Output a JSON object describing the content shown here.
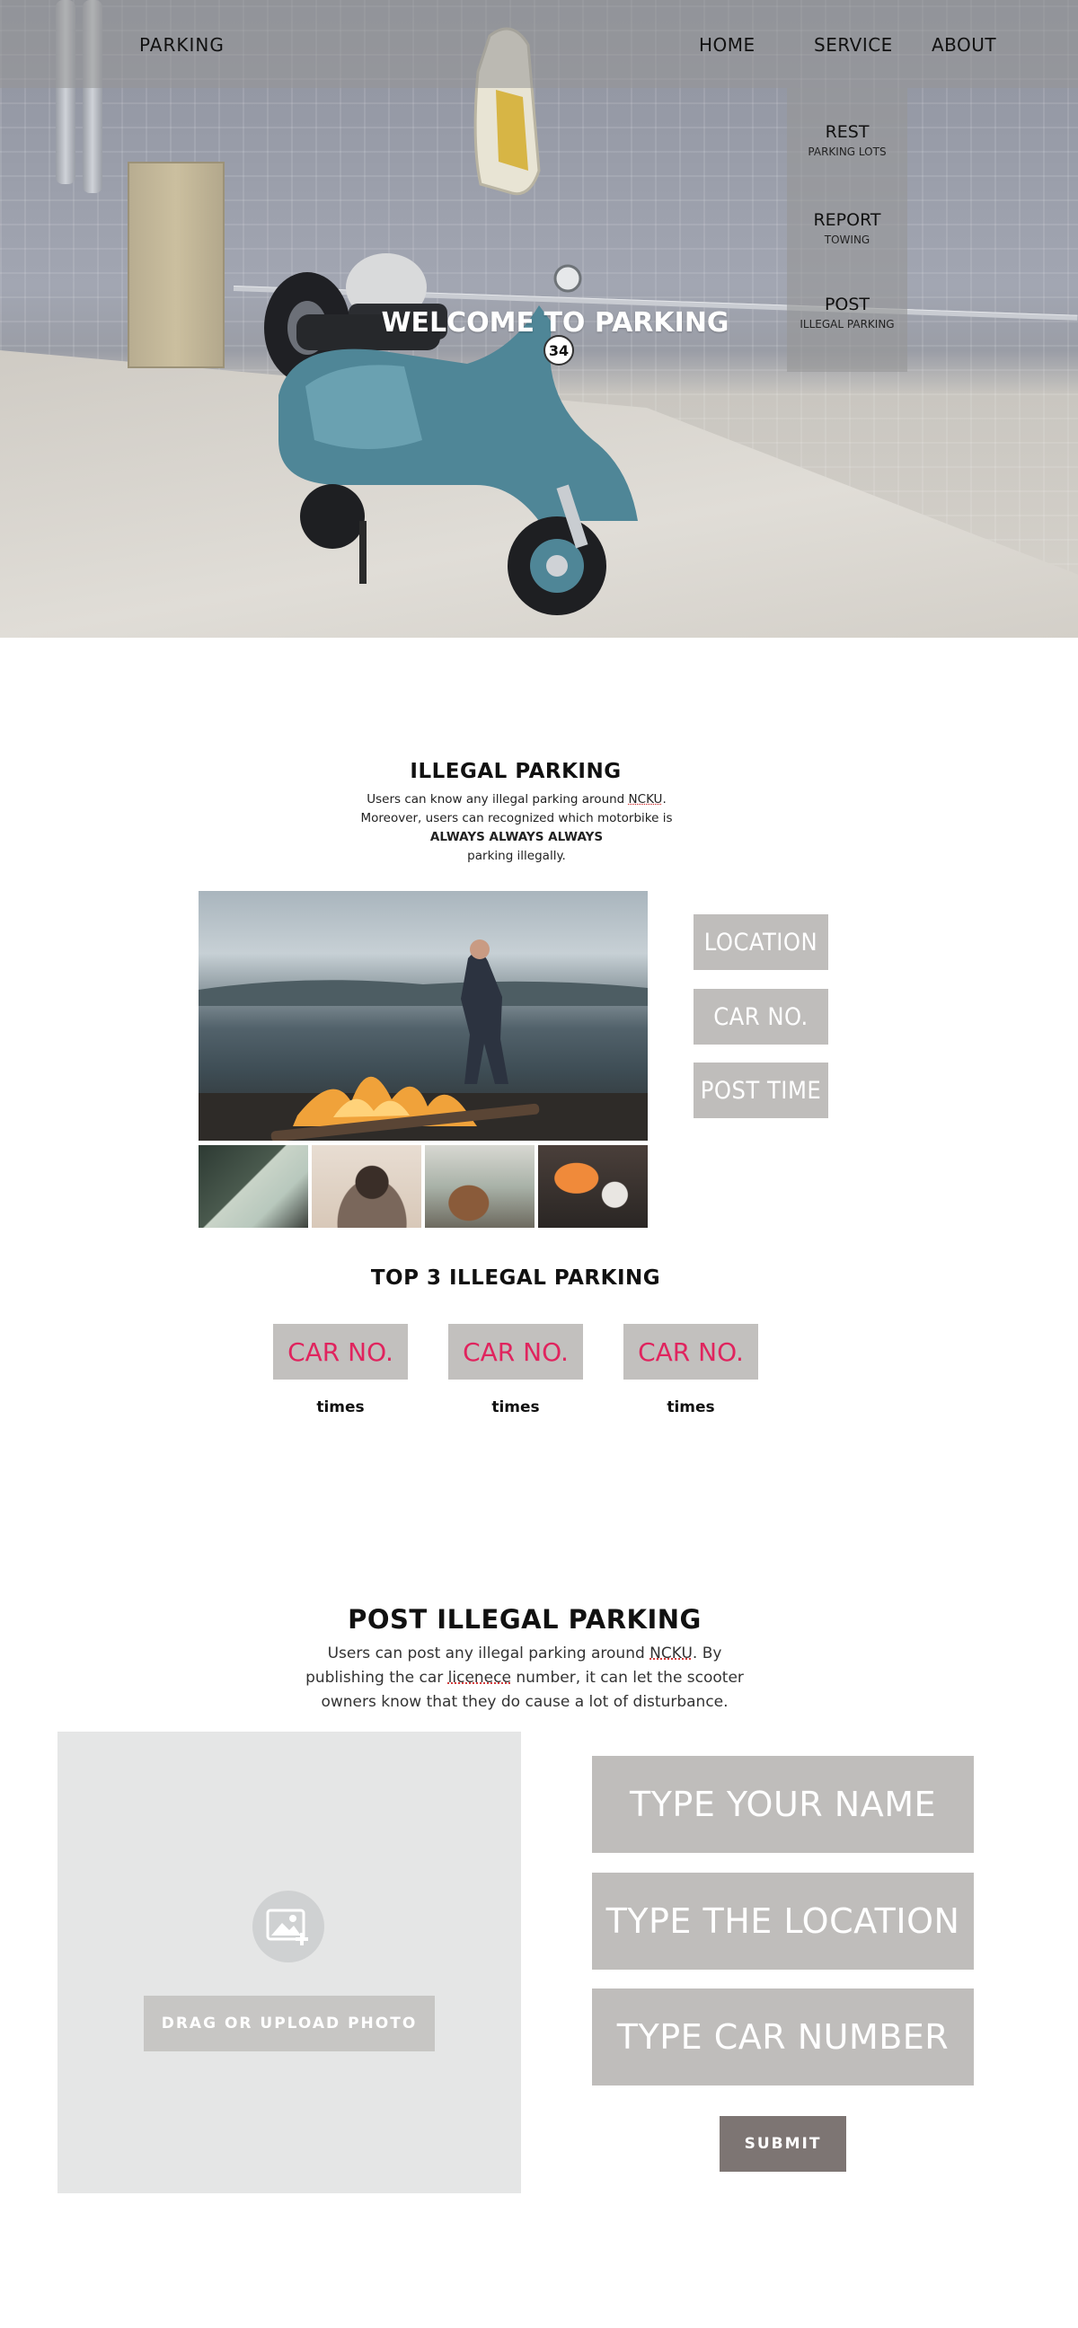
{
  "nav": {
    "brand": "PARKING",
    "links": [
      "HOME",
      "SERVICE",
      "ABOUT"
    ],
    "dropdown": [
      {
        "title": "REST",
        "sub": "PARKING LOTS"
      },
      {
        "title": "REPORT",
        "sub": "TOWING"
      },
      {
        "title": "POST",
        "sub": "ILLEGAL PARKING"
      }
    ]
  },
  "hero": {
    "title": "WELCOME TO PARKING",
    "plate_number": "34"
  },
  "illegal": {
    "title": "ILLEGAL PARKING",
    "line1_pre": "Users can know any illegal parking around ",
    "line1_link": "NCKU",
    "line1_post": ".",
    "line2": "Moreover, users can recognized which motorbike is",
    "line3": "ALWAYS ALWAYS ALWAYS",
    "line4": "parking illegally.",
    "buttons": [
      "LOCATION",
      "CAR NO.",
      "POST TIME"
    ]
  },
  "top3": {
    "title": "TOP 3 ILLEGAL PARKING",
    "cards": [
      {
        "label": "CAR NO.",
        "times": "times"
      },
      {
        "label": "CAR NO.",
        "times": "times"
      },
      {
        "label": "CAR NO.",
        "times": "times"
      }
    ]
  },
  "post": {
    "title": "POST ILLEGAL PARKING",
    "line1_pre": "Users can post any illegal parking around ",
    "line1_link": "NCKU",
    "line1_post": ". By",
    "line2_pre": "publishing the car ",
    "line2_link": "licenece",
    "line2_post": " number, it can let the scooter",
    "line3": "owners know that they do cause a lot of disturbance.",
    "upload_label": "DRAG OR UPLOAD PHOTO",
    "fields": [
      "TYPE YOUR NAME",
      "TYPE THE LOCATION",
      "TYPE CAR NUMBER"
    ],
    "submit_label": "SUBMIT"
  },
  "colors": {
    "accent_pink": "#e0245e",
    "button_gray": "#bfbdbb",
    "submit_gray": "#7d7573"
  },
  "icons": [
    "image-add-icon"
  ]
}
